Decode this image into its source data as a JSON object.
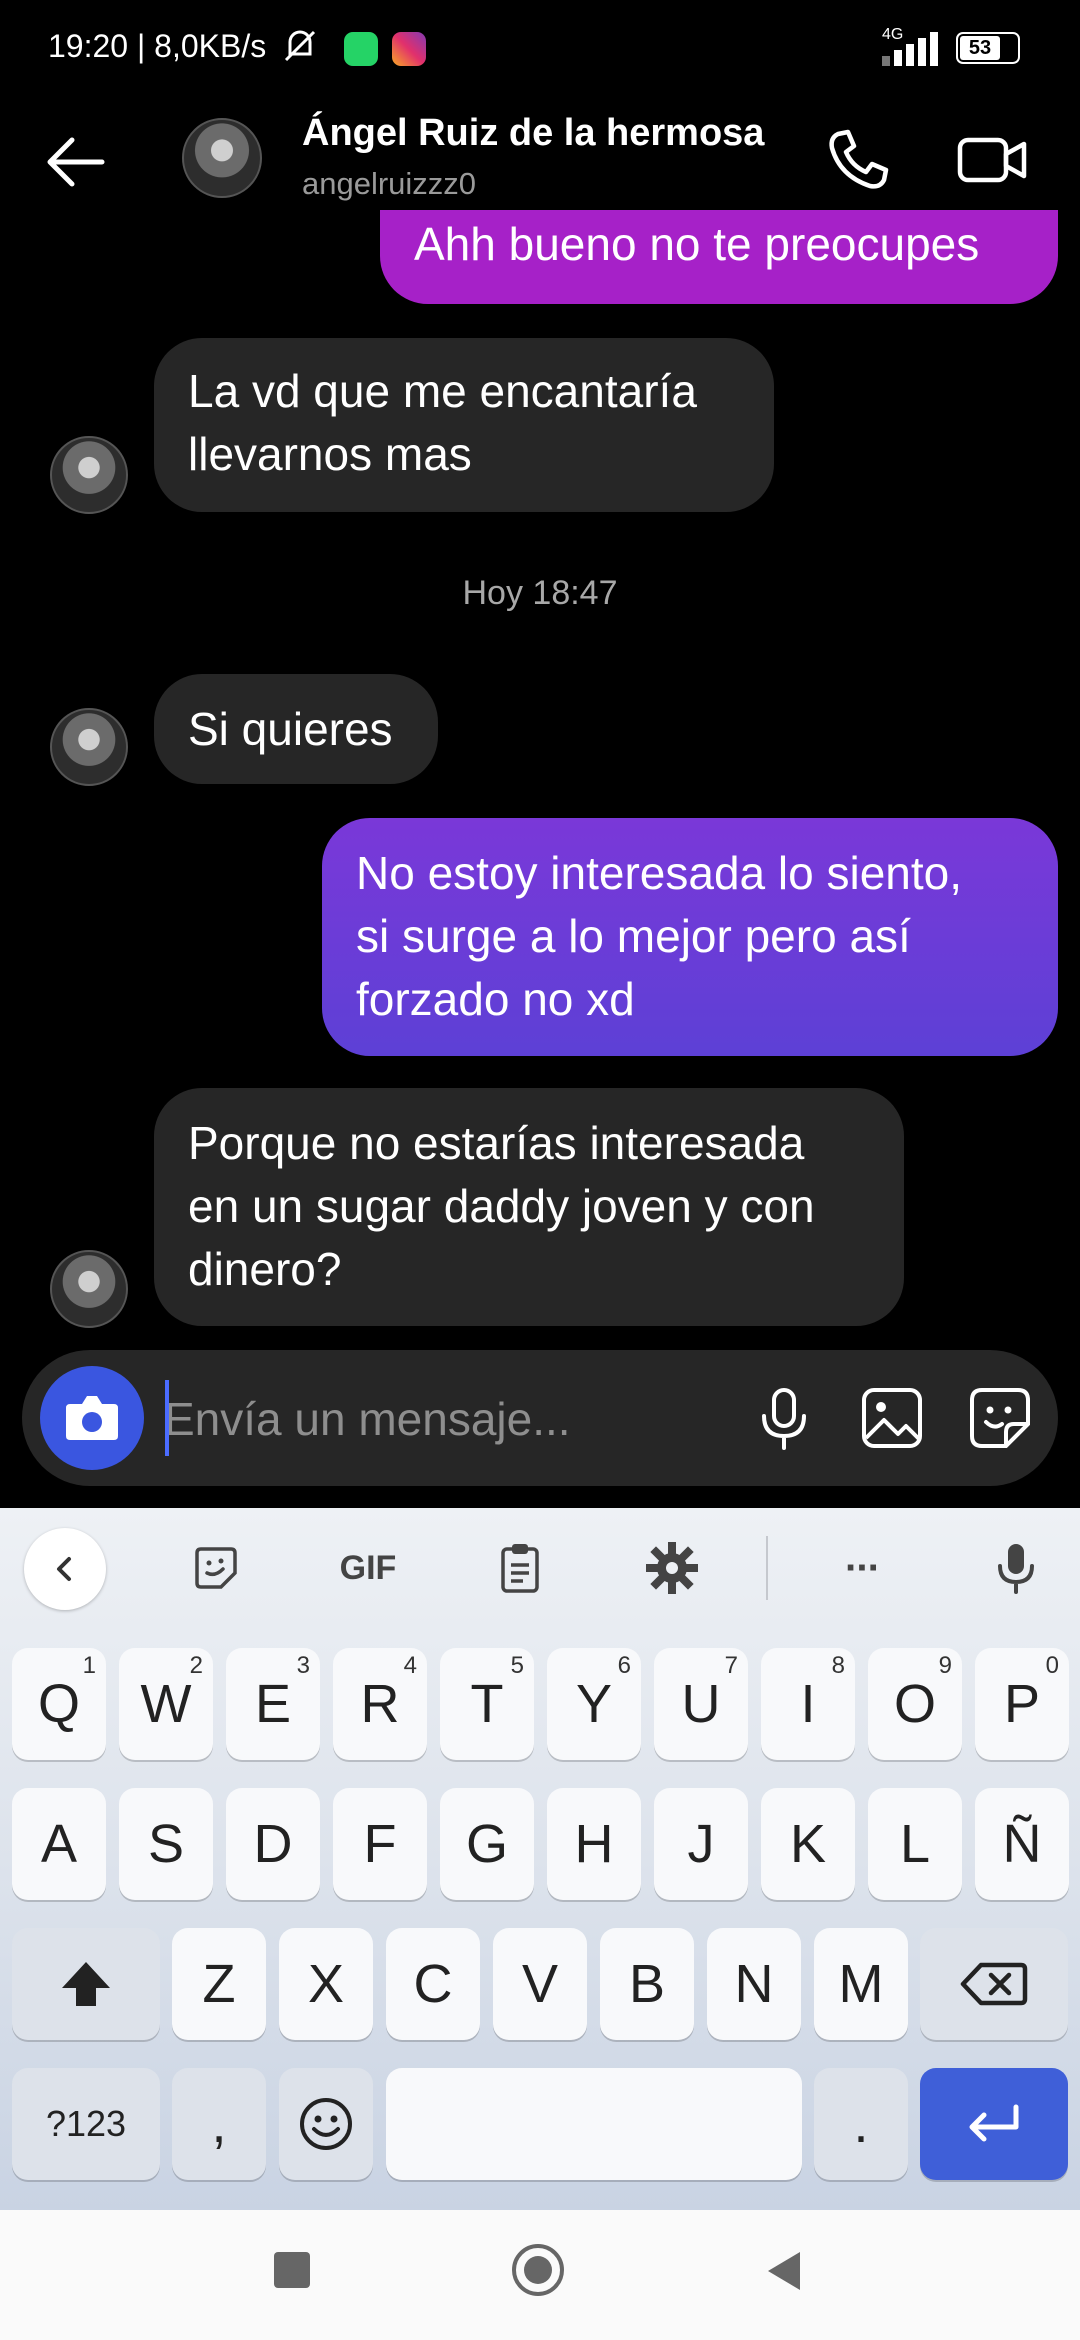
{
  "status_bar": {
    "time": "19:20 | 8,0KB/s",
    "network": "4G",
    "battery": "53"
  },
  "header": {
    "name": "Ángel Ruiz de la hermosa",
    "username": "angelruizzz0"
  },
  "messages": [
    {
      "type": "sent",
      "text": "Ahh bueno no te preocupes"
    },
    {
      "type": "received",
      "lines": [
        "La vd que me encantaría",
        "llevarnos mas"
      ]
    },
    {
      "type": "timestamp",
      "text": "Hoy 18:47"
    },
    {
      "type": "received",
      "lines": [
        "Si quieres"
      ]
    },
    {
      "type": "sent",
      "lines": [
        "No estoy interesada lo siento,",
        "si surge a lo mejor pero así",
        "forzado no xd"
      ]
    },
    {
      "type": "received",
      "lines": [
        "Porque no estarías interesada",
        "en un sugar daddy joven y con",
        "dinero?"
      ]
    }
  ],
  "composer": {
    "placeholder": "Envía un mensaje..."
  },
  "keyboard": {
    "toolbar": {
      "gif_label": "GIF",
      "more_label": "···"
    },
    "row1": [
      {
        "k": "Q",
        "n": "1"
      },
      {
        "k": "W",
        "n": "2"
      },
      {
        "k": "E",
        "n": "3"
      },
      {
        "k": "R",
        "n": "4"
      },
      {
        "k": "T",
        "n": "5"
      },
      {
        "k": "Y",
        "n": "6"
      },
      {
        "k": "U",
        "n": "7"
      },
      {
        "k": "I",
        "n": "8"
      },
      {
        "k": "O",
        "n": "9"
      },
      {
        "k": "P",
        "n": "0"
      }
    ],
    "row2": [
      "A",
      "S",
      "D",
      "F",
      "G",
      "H",
      "J",
      "K",
      "L",
      "Ñ"
    ],
    "row3": [
      "Z",
      "X",
      "C",
      "V",
      "B",
      "N",
      "M"
    ],
    "row4": {
      "symbols": "?123",
      "comma": ",",
      "period": "."
    }
  },
  "colors": {
    "sent_gradient_top": "#a621c8",
    "sent_gradient_bottom": "#5b3fd6",
    "accent": "#3a56e0"
  }
}
